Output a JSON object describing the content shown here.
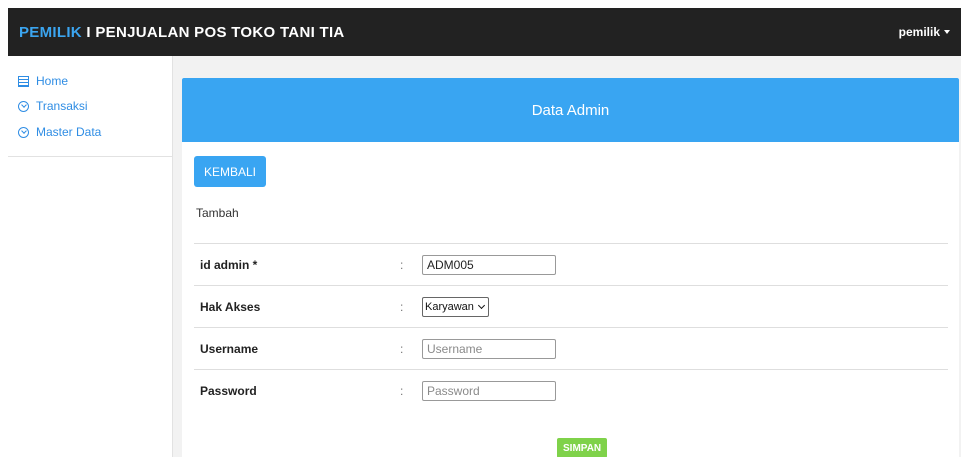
{
  "navbar": {
    "brand_accent": "PEMILIK",
    "brand_rest": " I PENJUALAN POS TOKO TANI TIA",
    "user_label": "pemilik"
  },
  "sidebar": {
    "items": [
      {
        "label": "Home",
        "icon": "home-icon"
      },
      {
        "label": "Transaksi",
        "icon": "chevron-circle-icon"
      },
      {
        "label": "Master Data",
        "icon": "chevron-circle-icon"
      }
    ]
  },
  "panel": {
    "title": "Data Admin",
    "back_label": "KEMBALI",
    "section": "Tambah"
  },
  "form": {
    "separator": ":",
    "id_admin": {
      "label": "id admin *",
      "value": "ADM005"
    },
    "hak_akses": {
      "label": "Hak Akses",
      "selected": "Karyawan"
    },
    "username": {
      "label": "Username",
      "placeholder": "Username"
    },
    "password": {
      "label": "Password",
      "placeholder": "Password"
    },
    "submit_label": "SIMPAN"
  },
  "colors": {
    "navbar_bg": "#222222",
    "accent_blue": "#39a5f2",
    "save_green": "#7fd24a"
  }
}
